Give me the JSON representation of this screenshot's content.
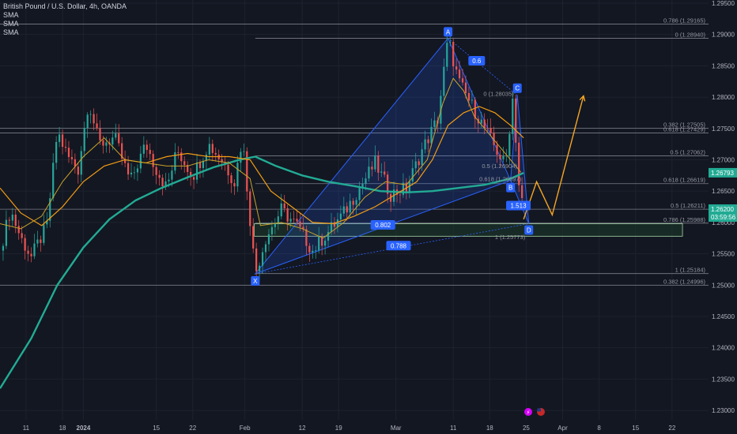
{
  "legend": {
    "title": "British Pound / U.S. Dollar, 4h, OANDA",
    "indicators": [
      "SMA",
      "SMA",
      "SMA"
    ]
  },
  "colors": {
    "background": "#131722",
    "up": "#26a69a",
    "down": "#ef5350",
    "pattern": "#2962ff",
    "sma_fast": "#c9a227",
    "sma_mid": "#f39c12",
    "sma_slow": "#22ab94",
    "projection": "#f5a623",
    "level_line": "#d1d4dc",
    "zone": "#1e3a2a"
  },
  "chart_data": {
    "type": "line",
    "symbol": "GBPUSD",
    "timeframe": "4h",
    "ylim": [
      1.2285,
      1.2955
    ],
    "y_ticks": [
      "1.29500",
      "1.29000",
      "1.28500",
      "1.28000",
      "1.27500",
      "1.27000",
      "1.26500",
      "1.26000",
      "1.25500",
      "1.25000",
      "1.24500",
      "1.24000",
      "1.23500",
      "1.23000"
    ],
    "x_ticks": [
      "11",
      "18",
      "2024",
      "15",
      "22",
      "Feb",
      "12",
      "19",
      "Mar",
      "11",
      "18",
      "25",
      "Apr",
      "8",
      "15",
      "22"
    ],
    "x_tick_days": [
      -51,
      -44,
      -40,
      -26,
      -19,
      -9,
      2,
      9,
      20,
      31,
      38,
      45,
      52,
      59,
      66,
      73
    ],
    "last_price": {
      "label": "1.26200",
      "countdown": "03:59:56",
      "value": 1.262
    },
    "sma_price": {
      "label": "1.26793",
      "value": 1.26793
    },
    "price_path": [
      {
        "x": -56,
        "y": 1.2555
      },
      {
        "x": -54,
        "y": 1.262
      },
      {
        "x": -52,
        "y": 1.2575
      },
      {
        "x": -50,
        "y": 1.2545
      },
      {
        "x": -47,
        "y": 1.2595
      },
      {
        "x": -45,
        "y": 1.2745
      },
      {
        "x": -43,
        "y": 1.2705
      },
      {
        "x": -41,
        "y": 1.2685
      },
      {
        "x": -39,
        "y": 1.2795
      },
      {
        "x": -37,
        "y": 1.2725
      },
      {
        "x": -34,
        "y": 1.2735
      },
      {
        "x": -31,
        "y": 1.2665
      },
      {
        "x": -28,
        "y": 1.2725
      },
      {
        "x": -26,
        "y": 1.2685
      },
      {
        "x": -24,
        "y": 1.2655
      },
      {
        "x": -22,
        "y": 1.2715
      },
      {
        "x": -19,
        "y": 1.2675
      },
      {
        "x": -16,
        "y": 1.2725
      },
      {
        "x": -13,
        "y": 1.2695
      },
      {
        "x": -11,
        "y": 1.2665
      },
      {
        "x": -9.5,
        "y": 1.2735
      },
      {
        "x": -8,
        "y": 1.2605
      },
      {
        "x": -7,
        "y": 1.2518
      },
      {
        "x": -5,
        "y": 1.2575
      },
      {
        "x": -2,
        "y": 1.262
      },
      {
        "x": 1,
        "y": 1.2595
      },
      {
        "x": 4,
        "y": 1.2555
      },
      {
        "x": 7,
        "y": 1.2585
      },
      {
        "x": 10,
        "y": 1.2615
      },
      {
        "x": 13,
        "y": 1.2655
      },
      {
        "x": 16,
        "y": 1.2695
      },
      {
        "x": 19,
        "y": 1.2645
      },
      {
        "x": 22,
        "y": 1.2655
      },
      {
        "x": 25,
        "y": 1.2715
      },
      {
        "x": 28,
        "y": 1.2765
      },
      {
        "x": 30,
        "y": 1.2893
      },
      {
        "x": 32,
        "y": 1.2825
      },
      {
        "x": 34,
        "y": 1.2795
      },
      {
        "x": 36,
        "y": 1.2765
      },
      {
        "x": 38,
        "y": 1.2735
      },
      {
        "x": 40,
        "y": 1.2705
      },
      {
        "x": 41,
        "y": 1.269
      },
      {
        "x": 42.5,
        "y": 1.2805
      },
      {
        "x": 43.5,
        "y": 1.2665
      },
      {
        "x": 44.5,
        "y": 1.262
      }
    ],
    "sma_fast": [
      {
        "x": -56,
        "y": 1.2598
      },
      {
        "x": -52,
        "y": 1.259
      },
      {
        "x": -48,
        "y": 1.261
      },
      {
        "x": -44,
        "y": 1.2665
      },
      {
        "x": -40,
        "y": 1.2705
      },
      {
        "x": -36,
        "y": 1.2735
      },
      {
        "x": -32,
        "y": 1.27
      },
      {
        "x": -28,
        "y": 1.2695
      },
      {
        "x": -24,
        "y": 1.269
      },
      {
        "x": -20,
        "y": 1.269
      },
      {
        "x": -16,
        "y": 1.27
      },
      {
        "x": -12,
        "y": 1.2695
      },
      {
        "x": -8,
        "y": 1.267
      },
      {
        "x": -6,
        "y": 1.2595
      },
      {
        "x": -2,
        "y": 1.26
      },
      {
        "x": 2,
        "y": 1.259
      },
      {
        "x": 6,
        "y": 1.2575
      },
      {
        "x": 10,
        "y": 1.26
      },
      {
        "x": 14,
        "y": 1.264
      },
      {
        "x": 18,
        "y": 1.2665
      },
      {
        "x": 22,
        "y": 1.266
      },
      {
        "x": 26,
        "y": 1.27
      },
      {
        "x": 29,
        "y": 1.279
      },
      {
        "x": 31,
        "y": 1.283
      },
      {
        "x": 33,
        "y": 1.281
      },
      {
        "x": 35,
        "y": 1.277
      },
      {
        "x": 38,
        "y": 1.274
      },
      {
        "x": 41,
        "y": 1.271
      },
      {
        "x": 44,
        "y": 1.268
      }
    ],
    "sma_mid": [
      {
        "x": -56,
        "y": 1.2655
      },
      {
        "x": -52,
        "y": 1.2615
      },
      {
        "x": -48,
        "y": 1.2595
      },
      {
        "x": -44,
        "y": 1.2625
      },
      {
        "x": -40,
        "y": 1.2665
      },
      {
        "x": -36,
        "y": 1.269
      },
      {
        "x": -32,
        "y": 1.27
      },
      {
        "x": -28,
        "y": 1.2695
      },
      {
        "x": -24,
        "y": 1.2705
      },
      {
        "x": -20,
        "y": 1.271
      },
      {
        "x": -16,
        "y": 1.2705
      },
      {
        "x": -12,
        "y": 1.2705
      },
      {
        "x": -8,
        "y": 1.27
      },
      {
        "x": -4,
        "y": 1.265
      },
      {
        "x": 0,
        "y": 1.2625
      },
      {
        "x": 4,
        "y": 1.26
      },
      {
        "x": 8,
        "y": 1.2598
      },
      {
        "x": 12,
        "y": 1.261
      },
      {
        "x": 16,
        "y": 1.2625
      },
      {
        "x": 20,
        "y": 1.2645
      },
      {
        "x": 24,
        "y": 1.2665
      },
      {
        "x": 27,
        "y": 1.27
      },
      {
        "x": 30,
        "y": 1.2755
      },
      {
        "x": 33,
        "y": 1.2775
      },
      {
        "x": 36,
        "y": 1.2785
      },
      {
        "x": 39,
        "y": 1.2775
      },
      {
        "x": 42,
        "y": 1.2755
      },
      {
        "x": 44.5,
        "y": 1.2735
      }
    ],
    "sma_slow": [
      {
        "x": -56,
        "y": 1.2335
      },
      {
        "x": -50,
        "y": 1.2415
      },
      {
        "x": -45,
        "y": 1.25
      },
      {
        "x": -40,
        "y": 1.256
      },
      {
        "x": -35,
        "y": 1.2605
      },
      {
        "x": -30,
        "y": 1.2635
      },
      {
        "x": -25,
        "y": 1.2655
      },
      {
        "x": -20,
        "y": 1.2672
      },
      {
        "x": -15,
        "y": 1.2688
      },
      {
        "x": -10,
        "y": 1.27
      },
      {
        "x": -7,
        "y": 1.2705
      },
      {
        "x": -3,
        "y": 1.269
      },
      {
        "x": 2,
        "y": 1.2675
      },
      {
        "x": 7,
        "y": 1.2665
      },
      {
        "x": 12,
        "y": 1.2658
      },
      {
        "x": 17,
        "y": 1.265
      },
      {
        "x": 22,
        "y": 1.2648
      },
      {
        "x": 27,
        "y": 1.265
      },
      {
        "x": 32,
        "y": 1.2655
      },
      {
        "x": 37,
        "y": 1.266
      },
      {
        "x": 42,
        "y": 1.267
      },
      {
        "x": 44.5,
        "y": 1.2679
      }
    ],
    "fib_levels": [
      {
        "label": "0.786 (1.29165)",
        "value": 1.29165,
        "x_start": -56
      },
      {
        "label": "0 (1.28940)",
        "value": 1.2894,
        "x_start": -7
      },
      {
        "label": "0.382 (1.27505)",
        "value": 1.27505,
        "x_start": -56
      },
      {
        "label": "0.618 (1.27429)",
        "value": 1.27429,
        "x_start": -56
      },
      {
        "label": "0.5 (1.27062)",
        "value": 1.27062,
        "x_start": -7
      },
      {
        "label": "0.618 (1.26619)",
        "value": 1.26619,
        "x_start": -7
      },
      {
        "label": "0.5 (1.26211)",
        "value": 1.26211,
        "x_start": -56
      },
      {
        "label": "0.786 (1.25988)",
        "value": 1.25988,
        "x_start": -7
      },
      {
        "label": "1 (1.25184)",
        "value": 1.25184,
        "x_start": -7
      },
      {
        "label": "0.382 (1.24996)",
        "value": 1.24996,
        "x_start": -56
      }
    ],
    "inner_labels": [
      {
        "label": "0 (1.28035)",
        "x": 36.8,
        "y": 1.2806
      },
      {
        "label": "0.5 (1.26904)",
        "x": 36.5,
        "y": 1.26904
      },
      {
        "label": "0.618 (1.26697)",
        "x": 36,
        "y": 1.26697
      },
      {
        "label": "1 (1.25773)",
        "x": 39,
        "y": 1.25773
      }
    ],
    "zone": {
      "y_top": 1.2598,
      "y_bottom": 1.2578,
      "x_start": -7.2,
      "x_end": 75
    },
    "xabcd": {
      "points": [
        {
          "name": "X",
          "x": -7,
          "y": 1.2518
        },
        {
          "name": "A",
          "x": 30,
          "y": 1.2894
        },
        {
          "name": "B",
          "x": 42,
          "y": 1.2667
        },
        {
          "name": "C",
          "x": 43.3,
          "y": 1.2803
        },
        {
          "name": "D",
          "x": 45.5,
          "y": 1.2598
        }
      ],
      "ratios": [
        {
          "label": "0.6",
          "x": 35.5,
          "y": 1.2858
        },
        {
          "label": "0.802",
          "x": 17.5,
          "y": 1.2596
        },
        {
          "label": "1.513",
          "x": 43.5,
          "y": 1.2627
        },
        {
          "label": "0.788",
          "x": 20.5,
          "y": 1.2563
        }
      ]
    },
    "projection": [
      {
        "x": 44.5,
        "y": 1.2605
      },
      {
        "x": 47,
        "y": 1.2665
      },
      {
        "x": 50,
        "y": 1.2612
      },
      {
        "x": 56,
        "y": 1.2802
      }
    ]
  }
}
